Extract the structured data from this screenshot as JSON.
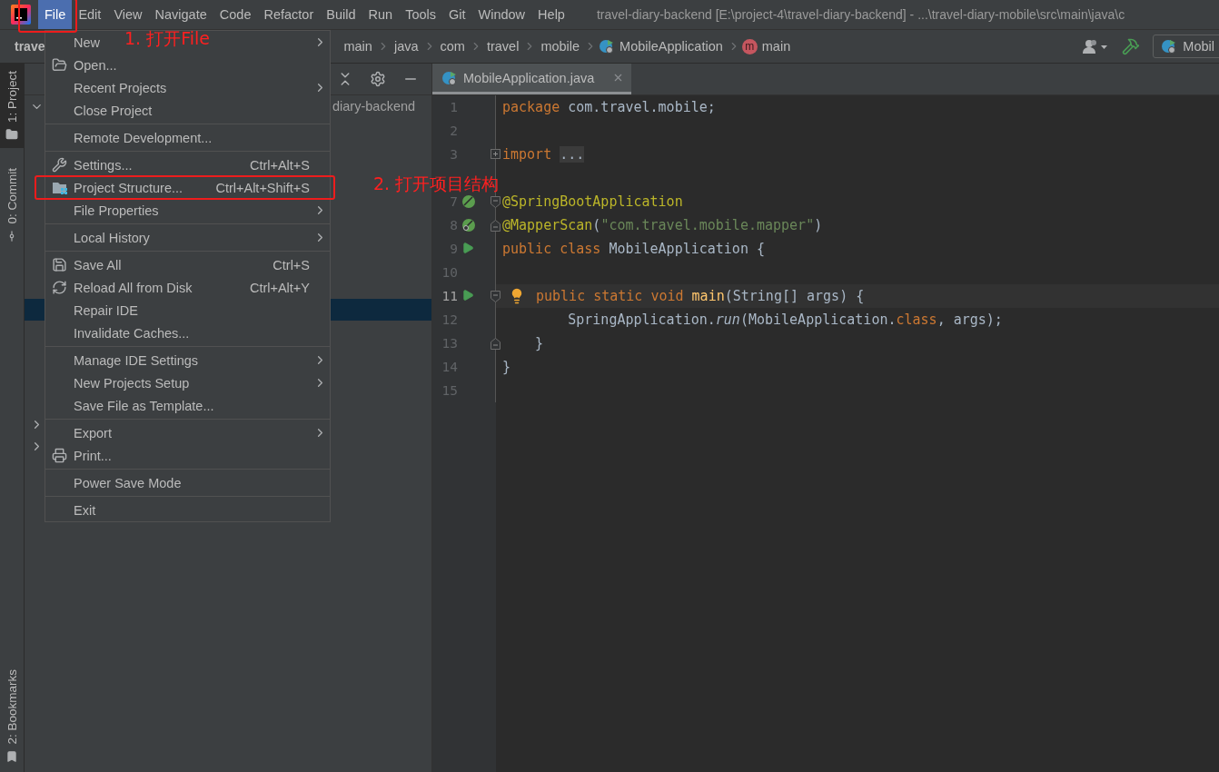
{
  "menu_bar": {
    "items": [
      {
        "label": "File",
        "selected": true
      },
      {
        "label": "Edit",
        "selected": false
      },
      {
        "label": "View",
        "selected": false
      },
      {
        "label": "Navigate",
        "selected": false
      },
      {
        "label": "Code",
        "selected": false
      },
      {
        "label": "Refactor",
        "selected": false
      },
      {
        "label": "Build",
        "selected": false
      },
      {
        "label": "Run",
        "selected": false
      },
      {
        "label": "Tools",
        "selected": false
      },
      {
        "label": "Git",
        "selected": false
      },
      {
        "label": "Window",
        "selected": false
      },
      {
        "label": "Help",
        "selected": false
      }
    ],
    "title": "travel-diary-backend [E:\\project-4\\travel-diary-backend] - ...\\travel-diary-mobile\\src\\main\\java\\c"
  },
  "nav_bar": {
    "project": "trave",
    "breadcrumbs": [
      {
        "label": "main",
        "kind": "folder"
      },
      {
        "label": "java",
        "kind": "folder"
      },
      {
        "label": "com",
        "kind": "folder"
      },
      {
        "label": "travel",
        "kind": "folder"
      },
      {
        "label": "mobile",
        "kind": "folder"
      },
      {
        "label": "MobileApplication",
        "kind": "class"
      },
      {
        "label": "main",
        "kind": "method",
        "badge": "m"
      }
    ],
    "run_config": "Mobil"
  },
  "tool_strip": [
    {
      "label": "1: Project",
      "selected": true,
      "kind": "project"
    },
    {
      "label": "0: Commit",
      "selected": false,
      "kind": "commit"
    },
    {
      "label": "2: Bookmarks",
      "selected": false,
      "kind": "bookmarks"
    }
  ],
  "project_panel": {
    "rows": [
      {
        "label": "diary-backend",
        "expanded": true,
        "selected": false
      },
      {
        "selected": true
      },
      {
        "expanded": false,
        "selected": false
      },
      {
        "expanded": false,
        "selected": false
      }
    ]
  },
  "editor": {
    "tab": {
      "label": "MobileApplication.java",
      "selected": true
    },
    "lines": [
      {
        "number": "1",
        "current": false,
        "tokens": [
          {
            "kind": "keyword",
            "text": "package"
          },
          {
            "kind": "plain",
            "text": " com.travel.mobile;"
          }
        ]
      },
      {
        "number": "2",
        "current": false
      },
      {
        "number": "3",
        "current": false,
        "fold": {
          "kind": "expand"
        },
        "tokens": [
          {
            "kind": "keyword",
            "text": "import "
          },
          {
            "kind": "folded",
            "text": "..."
          }
        ]
      },
      {
        "number": "7",
        "current": false,
        "gutter": {
          "kind": "bean"
        },
        "fold": {
          "kind": "start"
        },
        "tokens": [
          {
            "kind": "annotation",
            "text": "@SpringBootApplication"
          }
        ]
      },
      {
        "number": "8",
        "current": false,
        "gutter": {
          "kind": "bean-search"
        },
        "fold": {
          "kind": "end"
        },
        "tokens": [
          {
            "kind": "annotation",
            "text": "@MapperScan"
          },
          {
            "kind": "plain",
            "text": "("
          },
          {
            "kind": "string",
            "text": "\"com.travel.mobile.mapper\""
          },
          {
            "kind": "plain",
            "text": ")"
          }
        ]
      },
      {
        "number": "9",
        "current": false,
        "gutter": {
          "kind": "run"
        },
        "tokens": [
          {
            "kind": "keyword",
            "text": "public class"
          },
          {
            "kind": "plain",
            "text": " MobileApplication {"
          }
        ]
      },
      {
        "number": "10",
        "current": false
      },
      {
        "number": "11",
        "current": true,
        "gutter": {
          "kind": "run"
        },
        "fold": {
          "kind": "start"
        },
        "intention": {
          "kind": "bulb"
        },
        "tokens": [
          {
            "kind": "keyword",
            "text": "public static void "
          },
          {
            "kind": "method",
            "text": "main"
          },
          {
            "kind": "plain",
            "text": "(String[] args) {"
          }
        ]
      },
      {
        "number": "12",
        "current": false,
        "tokens": [
          {
            "kind": "plain",
            "text": "        SpringApplication."
          },
          {
            "kind": "italic",
            "text": "run"
          },
          {
            "kind": "plain",
            "text": "(MobileApplication."
          },
          {
            "kind": "keyword",
            "text": "class"
          },
          {
            "kind": "plain",
            "text": ", args);"
          }
        ]
      },
      {
        "number": "13",
        "current": false,
        "fold": {
          "kind": "end"
        },
        "tokens": [
          {
            "kind": "plain",
            "text": "    }"
          }
        ]
      },
      {
        "number": "14",
        "current": false,
        "tokens": [
          {
            "kind": "plain",
            "text": "}"
          }
        ]
      },
      {
        "number": "15",
        "current": false
      }
    ]
  },
  "file_menu": {
    "groups": [
      [
        {
          "label": "New",
          "kind": "plain",
          "submenu": true
        },
        {
          "label": "Open...",
          "kind": "open",
          "submenu": false
        },
        {
          "label": "Recent Projects",
          "kind": "plain",
          "submenu": true
        },
        {
          "label": "Close Project",
          "kind": "plain",
          "submenu": false
        }
      ],
      [
        {
          "label": "Remote Development...",
          "kind": "plain",
          "submenu": false
        }
      ],
      [
        {
          "label": "Settings...",
          "shortcut": "Ctrl+Alt+S",
          "kind": "wrench",
          "submenu": false
        },
        {
          "label": "Project Structure...",
          "shortcut": "Ctrl+Alt+Shift+S",
          "kind": "structure",
          "submenu": false
        },
        {
          "label": "File Properties",
          "kind": "plain",
          "submenu": true
        }
      ],
      [
        {
          "label": "Local History",
          "kind": "plain",
          "submenu": true
        }
      ],
      [
        {
          "label": "Save All",
          "shortcut": "Ctrl+S",
          "kind": "save",
          "submenu": false
        },
        {
          "label": "Reload All from Disk",
          "shortcut": "Ctrl+Alt+Y",
          "kind": "reload",
          "submenu": false
        },
        {
          "label": "Repair IDE",
          "kind": "plain",
          "submenu": false
        },
        {
          "label": "Invalidate Caches...",
          "kind": "plain",
          "submenu": false
        }
      ],
      [
        {
          "label": "Manage IDE Settings",
          "kind": "plain",
          "submenu": true
        },
        {
          "label": "New Projects Setup",
          "kind": "plain",
          "submenu": true
        },
        {
          "label": "Save File as Template...",
          "kind": "plain",
          "submenu": false
        }
      ],
      [
        {
          "label": "Export",
          "kind": "plain",
          "submenu": true
        },
        {
          "label": "Print...",
          "kind": "print",
          "submenu": false
        }
      ],
      [
        {
          "label": "Power Save Mode",
          "kind": "plain",
          "submenu": false
        }
      ],
      [
        {
          "label": "Exit",
          "kind": "plain",
          "submenu": false
        }
      ]
    ]
  },
  "annotations": [
    {
      "label": "1. 打开File"
    },
    {
      "label": "2. 打开项目结构"
    }
  ]
}
